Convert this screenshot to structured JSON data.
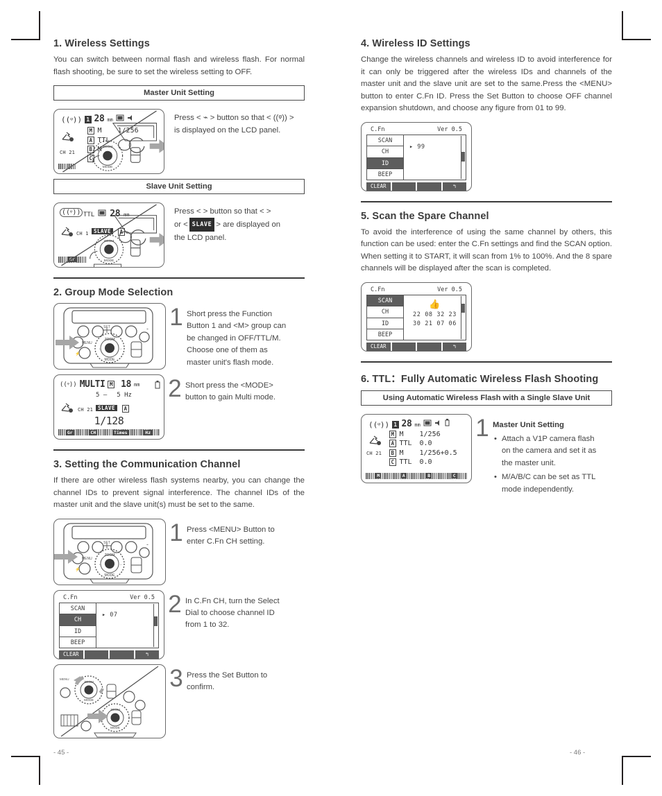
{
  "page": {
    "left_number": "- 45 -",
    "right_number": "- 46 -"
  },
  "sections": {
    "s1": {
      "heading": "1. Wireless Settings",
      "body": "You can switch between normal flash and wireless flash. For normal flash shooting, be sure to set the wireless setting to OFF.",
      "banner_master": "Master Unit Setting",
      "banner_slave": "Slave Unit Setting",
      "master_caption_1": "Press < ",
      "master_caption_2": " > button so that < ",
      "master_caption_3": " > is displayed on the LCD panel.",
      "master_text": "Press <  > button so that <  > is displayed on the LCD panel.",
      "slave_text_a": "Press <  > button so that <  >",
      "slave_text_b": "or < ",
      "slave_badge": "SLAVE",
      "slave_text_c": " > are displayed on",
      "slave_text_d": "the LCD panel."
    },
    "s2": {
      "heading": "2. Group Mode Selection",
      "step1_num": "1",
      "step1_text": "Short press the Function Button 1 and <M> group can be changed in OFF/TTL/M. Choose one of them as master unit's flash mode.",
      "step2_num": "2",
      "step2_text": "Short press the <MODE> button to gain Multi mode."
    },
    "s3": {
      "heading": "3. Setting the Communication Channel",
      "body": "If there are other wireless flash systems nearby, you can change the channel IDs to prevent signal interference. The channel IDs of the master unit and the slave unit(s) must be set to the same.",
      "step1_num": "1",
      "step1_text": "Press <MENU> Button to enter C.Fn CH setting.",
      "step2_num": "2",
      "step2_text": "In C.Fn CH, turn the Select Dial to choose channel ID from 1 to 32.",
      "step3_num": "3",
      "step3_text": "Press the Set Button to confirm."
    },
    "s4": {
      "heading": "4. Wireless ID Settings",
      "body": "Change the wireless channels and wireless ID to avoid interference for it can only be triggered after the wireless IDs and channels of the master unit and the slave unit are set to the same.Press the <MENU> button to enter C.Fn ID. Press the Set Button to choose OFF channel expansion shutdown, and choose any figure from 01 to 99."
    },
    "s5": {
      "heading": "5. Scan the Spare Channel",
      "body": "To avoid the interference of using the same channel by others, this function can be used: enter the C.Fn settings and find the SCAN option. When setting it to START, it will scan from 1% to 100%. And the 8 spare channels will be displayed after the scan is completed."
    },
    "s6": {
      "heading": "6. TTL：Fully Automatic Wireless Flash Shooting",
      "banner": "Using Automatic Wireless Flash with a Single Slave Unit",
      "step1_num": "1",
      "step1_title": "Master Unit Setting",
      "bullet1": "Attach a V1P camera flash on the camera and set it as the master unit.",
      "bullet2": "M/A/B/C can be set as TTL mode independently."
    }
  },
  "lcd_master": {
    "wifi": "((ᵠ))",
    "zoom_flag": "1",
    "focal": "28",
    "focal_unit": "mm",
    "ch": "CH 21",
    "rows": [
      {
        "group": "M",
        "mode": "M",
        "value": "1/256"
      },
      {
        "group": "A",
        "mode": "TTL",
        "value": ""
      },
      {
        "group": "B",
        "mode": "M",
        "value": ""
      },
      {
        "group": "C",
        "mode": "",
        "value": ""
      }
    ]
  },
  "lcd_slave": {
    "wifi": "((ᵠ))",
    "mode": "TTL",
    "focal": "28",
    "focal_unit": "mm",
    "ch": "CH 1",
    "slave_badge": "SLAVE",
    "group_badge": "A",
    "bottom_label": "Gr"
  },
  "lcd_multi": {
    "wifi": "((ᵠ))",
    "mode": "MULTI",
    "group_box": "M",
    "focal": "18",
    "focal_unit": "mm",
    "times": "5 –",
    "hz": "5 Hz",
    "ch": "CH 21",
    "slave_badge": "SLAVE",
    "group_badge": "A",
    "power": "1/128",
    "soft_keys": [
      "Gr",
      "CH",
      "Times",
      "Hz"
    ]
  },
  "lcd_ttl": {
    "wifi": "((ᵠ))",
    "zoom_flag": "1",
    "focal": "28",
    "focal_unit": "mm",
    "ch": "CH 21",
    "rows": [
      {
        "group": "M",
        "mode": "M",
        "value": "1/256"
      },
      {
        "group": "A",
        "mode": "TTL",
        "value": "0.0"
      },
      {
        "group": "B",
        "mode": "M",
        "value": "1/256+0.5"
      },
      {
        "group": "C",
        "mode": "TTL",
        "value": "0.0"
      }
    ],
    "soft_keys": [
      "M",
      "A",
      "B",
      "C"
    ]
  },
  "cfn_ch": {
    "title": "C.Fn",
    "version": "Ver 0.5",
    "menu": [
      "SCAN",
      "CH",
      "ID",
      "BEEP"
    ],
    "active": "CH",
    "value": "▸ 07",
    "footer": [
      "CLEAR",
      "",
      "",
      "↰"
    ]
  },
  "cfn_id": {
    "title": "C.Fn",
    "version": "Ver 0.5",
    "menu": [
      "SCAN",
      "CH",
      "ID",
      "BEEP"
    ],
    "active": "ID",
    "value": "▸ 99",
    "footer": [
      "CLEAR",
      "",
      "",
      "↰"
    ]
  },
  "cfn_scan": {
    "title": "C.Fn",
    "version": "Ver 0.5",
    "menu": [
      "SCAN",
      "CH",
      "ID",
      "BEEP"
    ],
    "active": "SCAN",
    "result_line1": "22 08 32 23",
    "result_line2": "30 21 07 06",
    "footer": [
      "CLEAR",
      "",
      "",
      "↰"
    ]
  },
  "flash_controls": {
    "menu_label": "MENU",
    "set_label": "SET",
    "zoom_label": "ZOOM",
    "mode_label": "MODE"
  }
}
